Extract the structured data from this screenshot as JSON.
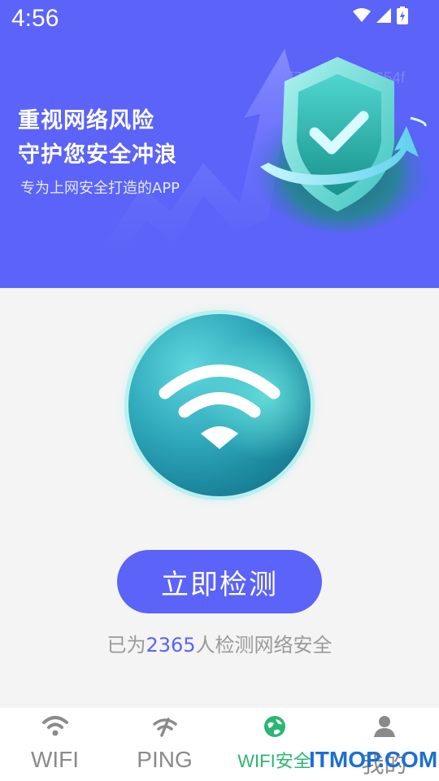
{
  "status_bar": {
    "time": "4:56"
  },
  "hero": {
    "title_line1": "重视网络风险",
    "title_line2": "守护您安全冲浪",
    "subtitle": "专为上网安全打造的APP",
    "code": "bf741a4379fe654f"
  },
  "main": {
    "scan_button": "立即检测",
    "stat_prefix": "已为",
    "stat_count": "2365",
    "stat_suffix": "人检测网络安全"
  },
  "tabbar": {
    "tabs": [
      {
        "label": "WIFI",
        "icon": "wifi-icon"
      },
      {
        "label": "PING",
        "icon": "ping-icon"
      },
      {
        "label": "WIFI安全",
        "icon": "globe-icon",
        "active": true
      },
      {
        "label": "我的",
        "icon": "user-icon"
      }
    ],
    "active_color": "#2bb673",
    "inactive_color": "#8a8a8a"
  },
  "watermark": "ITMOP.COM",
  "colors": {
    "primary": "#5b63f8",
    "background": "#f4f4f4"
  }
}
